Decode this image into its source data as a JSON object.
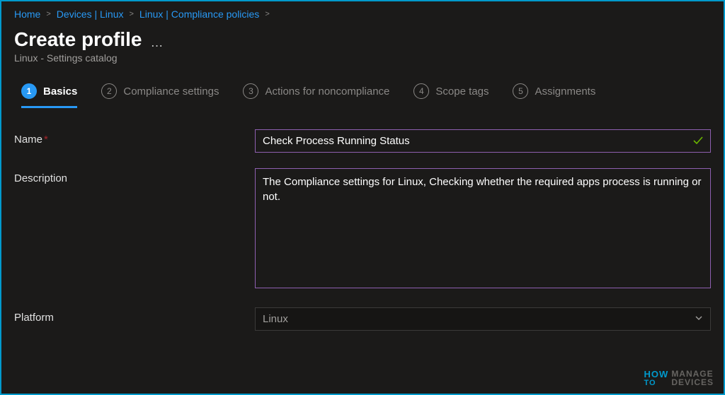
{
  "breadcrumb": {
    "items": [
      "Home",
      "Devices | Linux",
      "Linux | Compliance policies"
    ]
  },
  "header": {
    "title": "Create profile",
    "subtitle": "Linux - Settings catalog"
  },
  "tabs": [
    {
      "num": "1",
      "label": "Basics",
      "active": true
    },
    {
      "num": "2",
      "label": "Compliance settings",
      "active": false
    },
    {
      "num": "3",
      "label": "Actions for noncompliance",
      "active": false
    },
    {
      "num": "4",
      "label": "Scope tags",
      "active": false
    },
    {
      "num": "5",
      "label": "Assignments",
      "active": false
    }
  ],
  "form": {
    "name_label": "Name",
    "name_value": "Check Process Running Status",
    "description_label": "Description",
    "description_value": "The Compliance settings for Linux, Checking whether the required apps process is running or not.",
    "platform_label": "Platform",
    "platform_value": "Linux"
  },
  "watermark": {
    "how": "HOW",
    "to": "TO",
    "manage": "MANAGE",
    "devices": "DEVICES"
  }
}
